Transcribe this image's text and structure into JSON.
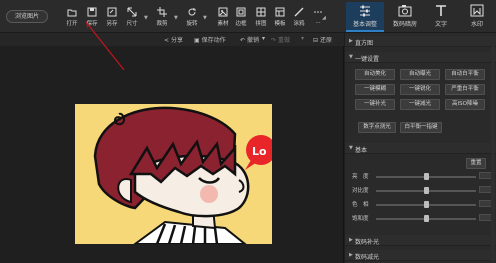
{
  "toolbar": {
    "browse_label": "浏览图片",
    "tools": [
      {
        "label": "打开",
        "icon": "folder-icon"
      },
      {
        "label": "保存",
        "icon": "save-icon"
      },
      {
        "label": "另存",
        "icon": "save-as-icon"
      },
      {
        "label": "尺寸",
        "icon": "resize-icon"
      },
      {
        "label": "裁剪",
        "icon": "crop-icon"
      },
      {
        "label": "旋转",
        "icon": "rotate-icon"
      },
      {
        "label": "素材",
        "icon": "sticker-icon"
      },
      {
        "label": "边框",
        "icon": "frame-icon"
      },
      {
        "label": "拼图",
        "icon": "collage-icon"
      },
      {
        "label": "模板",
        "icon": "template-icon"
      },
      {
        "label": "涂鸦",
        "icon": "brush-icon"
      },
      {
        "label": "...",
        "icon": "more-icon"
      }
    ]
  },
  "right_tabs": [
    {
      "label": "基本调整",
      "icon": "adjust-icon",
      "active": true
    },
    {
      "label": "数码暗房",
      "icon": "camera-icon",
      "active": false
    },
    {
      "label": "文字",
      "icon": "text-icon",
      "active": false
    },
    {
      "label": "水印",
      "icon": "watermark-icon",
      "active": false
    }
  ],
  "subbar": {
    "share": "分享",
    "save_action": "保存动作",
    "undo": "撤销",
    "redo": "重做",
    "reset": "还原"
  },
  "panel": {
    "histogram": "直方图",
    "one_click": "一键设置",
    "one_click_buttons": [
      "自动美化",
      "自动曝光",
      "自动白平衡",
      "一键模糊",
      "一键锐化",
      "严重白平衡",
      "一键补光",
      "一键减光",
      "高ISO降噪"
    ],
    "extra_buttons": [
      "数字点测光",
      "白平衡一指键"
    ],
    "basic": "基本",
    "reset_button": "重置",
    "sliders": [
      {
        "label": "亮　度",
        "value": 0.5
      },
      {
        "label": "对比度",
        "value": 0.5
      },
      {
        "label": "色　相",
        "value": 0.5
      },
      {
        "label": "饱和度",
        "value": 0.5
      }
    ],
    "digital_fill": "数码补光",
    "digital_reduce": "数码减光"
  },
  "photo": {
    "bubble_text": "Lo"
  },
  "colors": {
    "accent": "#2f7fc4",
    "arrow": "#c0161c",
    "photo_bg": "#f7d879",
    "hair": "#8a2230",
    "bubble": "#e8262a"
  }
}
